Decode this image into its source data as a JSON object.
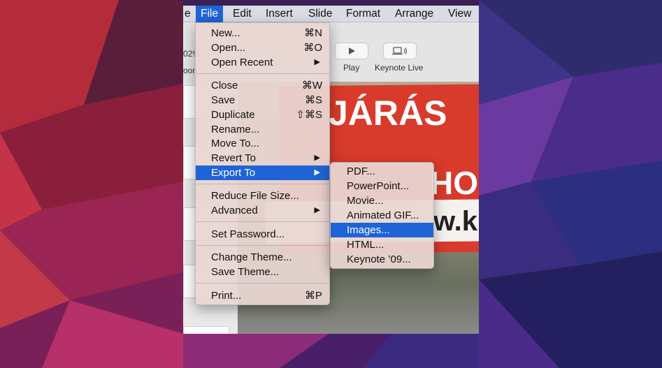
{
  "menubar": {
    "items": [
      "e",
      "File",
      "Edit",
      "Insert",
      "Slide",
      "Format",
      "Arrange",
      "View"
    ],
    "active_index": 1
  },
  "toolbar": {
    "play_label": "Play",
    "keynote_live_label": "Keynote Live",
    "zoom_fragment": "02%",
    "zoom_label_fragment": "oon"
  },
  "file_menu": {
    "items": [
      {
        "label": "New...",
        "shortcut": "⌘N"
      },
      {
        "label": "Open...",
        "shortcut": "⌘O"
      },
      {
        "label": "Open Recent",
        "submenu": true
      },
      {
        "label": "Close",
        "shortcut": "⌘W"
      },
      {
        "label": "Save",
        "shortcut": "⌘S"
      },
      {
        "label": "Duplicate",
        "shortcut": "⇧⌘S"
      },
      {
        "label": "Rename..."
      },
      {
        "label": "Move To..."
      },
      {
        "label": "Revert To",
        "submenu": true
      },
      {
        "label": "Export To",
        "submenu": true,
        "highlighted": true
      },
      {
        "label": "Reduce File Size..."
      },
      {
        "label": "Advanced",
        "submenu": true
      },
      {
        "label": "Set Password..."
      },
      {
        "label": "Change Theme..."
      },
      {
        "label": "Save Theme..."
      },
      {
        "label": "Print...",
        "shortcut": "⌘P"
      }
    ]
  },
  "export_menu": {
    "items": [
      {
        "label": "PDF..."
      },
      {
        "label": "PowerPoint..."
      },
      {
        "label": "Movie..."
      },
      {
        "label": "Animated GIF..."
      },
      {
        "label": "Images...",
        "highlighted": true
      },
      {
        "label": "HTML..."
      },
      {
        "label": "Keynote ’09..."
      }
    ]
  },
  "slide": {
    "line1": "JÁRÁS",
    "line2": "HO",
    "line3": "w.k"
  },
  "colors": {
    "highlight": "#1f64d6",
    "menu_bg": "#e9d6d1",
    "slide_red": "#d83a2c"
  }
}
